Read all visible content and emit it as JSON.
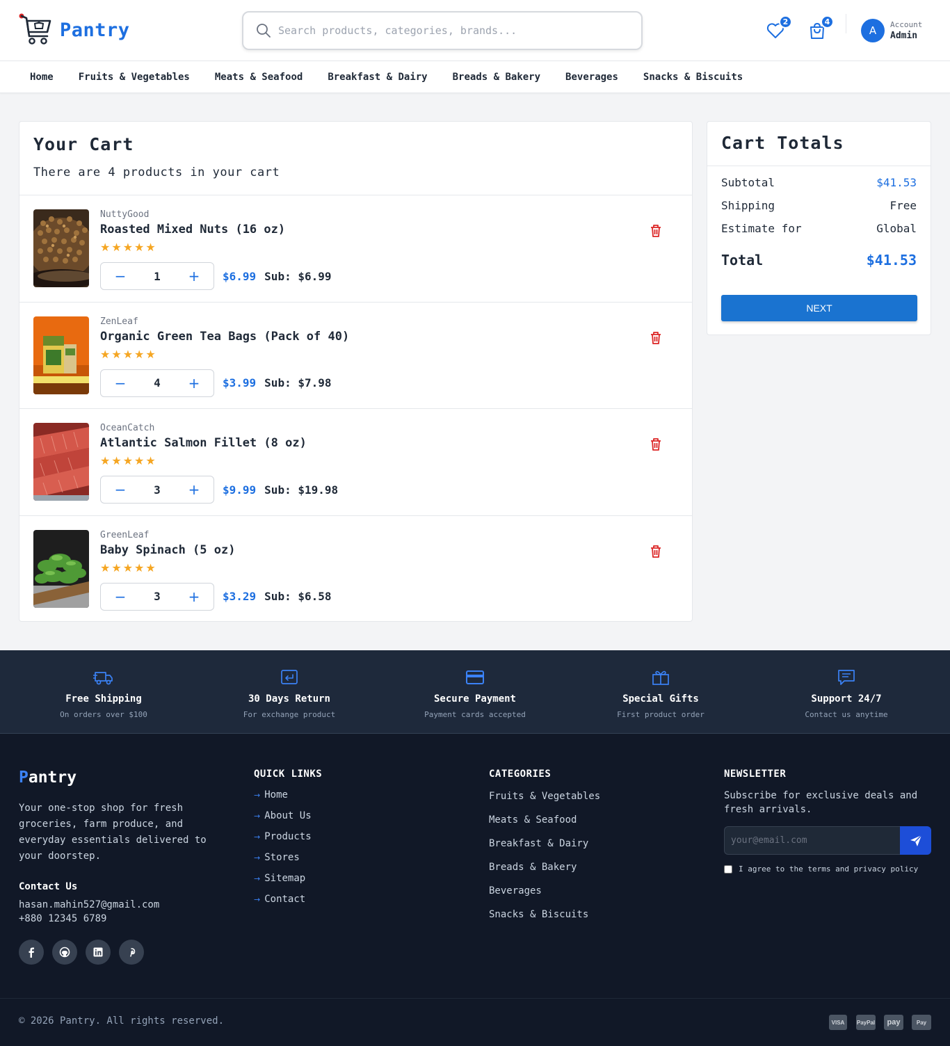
{
  "header": {
    "logo_text": "Pantry",
    "search_placeholder": "Search products, categories, brands...",
    "wishlist_count": "2",
    "cart_count": "4",
    "account_initial": "A",
    "account_label": "Account",
    "account_name": "Admin"
  },
  "nav": {
    "items": [
      "Home",
      "Fruits & Vegetables",
      "Meats & Seafood",
      "Breakfast & Dairy",
      "Breads & Bakery",
      "Beverages",
      "Snacks & Biscuits"
    ]
  },
  "cart": {
    "title": "Your Cart",
    "subtitle": "There are 4 products in your cart",
    "items": [
      {
        "brand": "NuttyGood",
        "name": "Roasted Mixed Nuts (16 oz)",
        "stars": "★★★★★",
        "qty": "1",
        "price": "$6.99",
        "sub": "Sub: $6.99",
        "image": "nuts-photo"
      },
      {
        "brand": "ZenLeaf",
        "name": "Organic Green Tea Bags (Pack of 40)",
        "stars": "★★★★★",
        "qty": "4",
        "price": "$3.99",
        "sub": "Sub: $7.98",
        "image": "tea-box-photo"
      },
      {
        "brand": "OceanCatch",
        "name": "Atlantic Salmon Fillet (8 oz)",
        "stars": "★★★★★",
        "qty": "3",
        "price": "$9.99",
        "sub": "Sub: $19.98",
        "image": "salmon-photo"
      },
      {
        "brand": "GreenLeaf",
        "name": "Baby Spinach (5 oz)",
        "stars": "★★★★★",
        "qty": "3",
        "price": "$3.29",
        "sub": "Sub: $6.58",
        "image": "spinach-photo"
      }
    ],
    "minus": "−",
    "plus": "+"
  },
  "totals": {
    "title": "Cart Totals",
    "subtotal_label": "Subtotal",
    "subtotal_value": "$41.53",
    "shipping_label": "Shipping",
    "shipping_value": "Free",
    "estimate_label": "Estimate for",
    "estimate_value": "Global",
    "total_label": "Total",
    "total_value": "$41.53",
    "next_label": "NEXT"
  },
  "features": [
    {
      "icon": "truck-icon",
      "title": "Free Shipping",
      "sub": "On orders over $100"
    },
    {
      "icon": "return-icon",
      "title": "30 Days Return",
      "sub": "For exchange product"
    },
    {
      "icon": "credit-card-icon",
      "title": "Secure Payment",
      "sub": "Payment cards accepted"
    },
    {
      "icon": "gift-icon",
      "title": "Special Gifts",
      "sub": "First product order"
    },
    {
      "icon": "chat-icon",
      "title": "Support 24/7",
      "sub": "Contact us anytime"
    }
  ],
  "footer": {
    "logo_p": "P",
    "logo_rest": "antry",
    "description": "Your one-stop shop for fresh groceries, farm produce, and everyday essentials delivered to your doorstep.",
    "contact_heading": "Contact Us",
    "email": "hasan.mahin527@gmail.com",
    "phone": "+880 12345 6789",
    "quick_links_heading": "QUICK LINKS",
    "quick_links": [
      "Home",
      "About Us",
      "Products",
      "Stores",
      "Sitemap",
      "Contact"
    ],
    "categories_heading": "CATEGORIES",
    "categories": [
      "Fruits & Vegetables",
      "Meats & Seafood",
      "Breakfast & Dairy",
      "Breads & Bakery",
      "Beverages",
      "Snacks & Biscuits"
    ],
    "newsletter_heading": "NEWSLETTER",
    "newsletter_text": "Subscribe for exclusive deals and fresh arrivals.",
    "email_placeholder": "your@email.com",
    "agree_text": "I agree to the terms and privacy policy",
    "copyright": "© 2026 Pantry. All rights reserved.",
    "payments": [
      "VISA",
      "PayPal",
      "pay",
      "Pay"
    ]
  },
  "colors": {
    "accent": "#1d6fe0",
    "delete": "#dc2626",
    "stars": "#f5a623",
    "footer_bg": "#111827",
    "features_bg": "#1e293b"
  }
}
